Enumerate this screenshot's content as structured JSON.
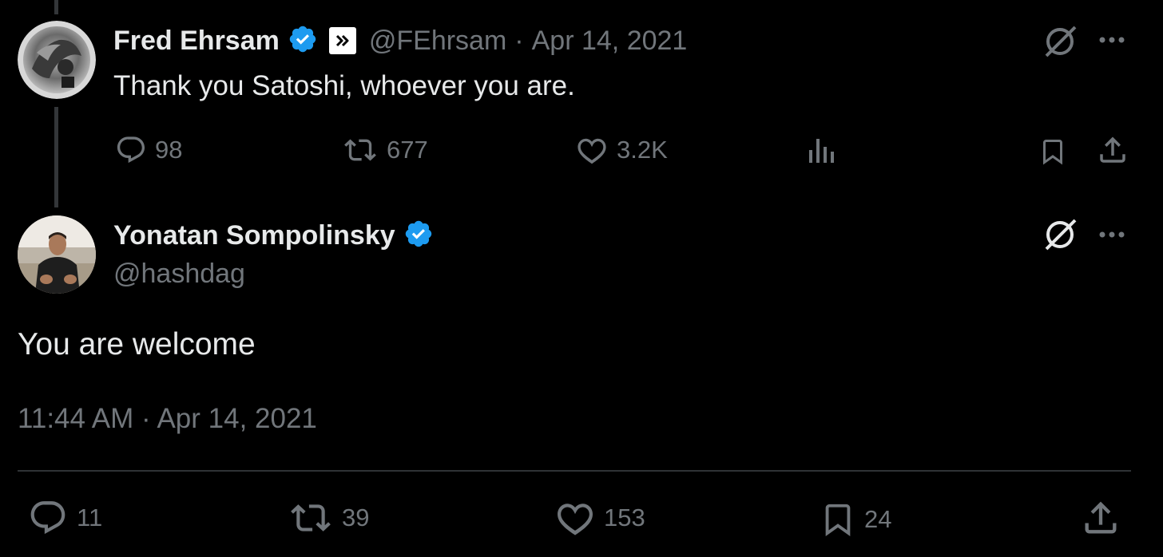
{
  "parent_tweet": {
    "display_name": "Fred Ehrsam",
    "handle": "@FEhrsam",
    "separator": "·",
    "date": "Apr 14, 2021",
    "text": "Thank you Satoshi, whoever you are.",
    "replies": "98",
    "retweets": "677",
    "likes": "3.2K",
    "avatar_icon": "avatar-fred-ehrsam",
    "badge_icon": "fast-forward-badge-icon",
    "verified_color": "#1d9bf0"
  },
  "main_tweet": {
    "display_name": "Yonatan Sompolinsky",
    "handle": "@hashdag",
    "text": "You are welcome",
    "timestamp": "11:44 AM · Apr 14, 2021",
    "replies": "11",
    "retweets": "39",
    "likes": "153",
    "bookmarks": "24",
    "avatar_icon": "avatar-yonatan-sompolinsky",
    "verified_color": "#1d9bf0"
  },
  "colors": {
    "background": "#000000",
    "text_primary": "#e7e9ea",
    "text_muted": "#71767b",
    "divider": "#2f3336"
  }
}
